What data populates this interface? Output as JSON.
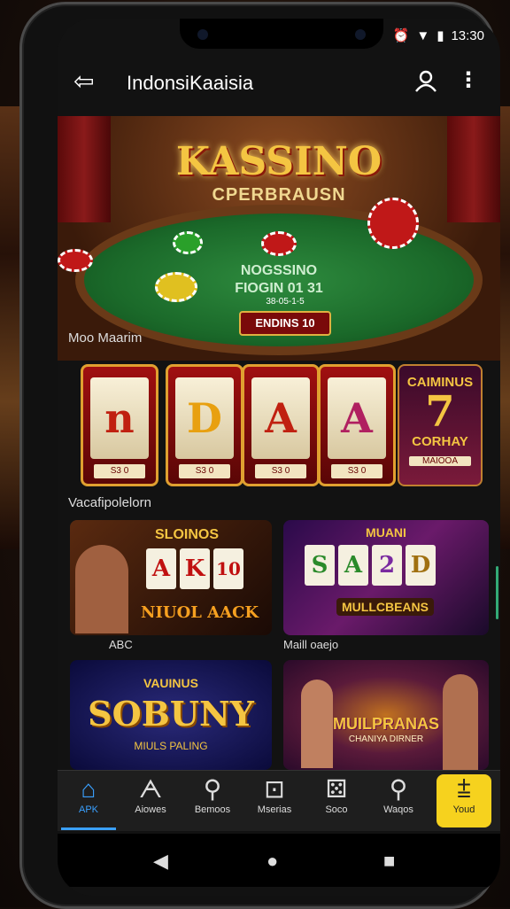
{
  "status": {
    "time": "13:30"
  },
  "appbar": {
    "title": "IndonsiKaaisia",
    "back_icon": "back-arrow-icon",
    "account_icon": "user-icon",
    "menu_icon": "more-vert-icon"
  },
  "hero": {
    "title": "KASSINO",
    "subtitle": "CPERBRAUSN",
    "table_line1": "NOGSSINO",
    "table_line2": "FIOGIN 01 31",
    "badge_top": "38-05-1-5",
    "badge": "ENDINS 10"
  },
  "sections": {
    "slots_label": "Moo Maarim",
    "featured_label": "Vacafipolelorn"
  },
  "reels": [
    {
      "symbol": "n",
      "tag": "S3 0"
    },
    {
      "symbol": "D",
      "tag": "S3 0"
    },
    {
      "symbol": "A",
      "tag": "S3 0"
    },
    {
      "symbol": "A",
      "tag": "S3 0"
    }
  ],
  "promo_tile": {
    "line1": "CAIMINUS",
    "number": "7",
    "line2": "CORHAY",
    "tag": "MAIOOA"
  },
  "cards": [
    {
      "header": "SLOINOS",
      "reels": [
        "A",
        "K",
        "10"
      ],
      "footer": "NIUOL AACK",
      "caption": "ABC"
    },
    {
      "header": "MUANI",
      "reels": [
        "S",
        "A",
        "2",
        "D"
      ],
      "footer": "MULLCBEANS",
      "caption": "Maill oaejo"
    },
    {
      "header": "VAUINUS",
      "title": "SOBUNY",
      "footer": "MIULS PALING"
    },
    {
      "header": "MUILPRANAS",
      "footer": "CHANIYA DIRNER"
    }
  ],
  "bottom_nav": [
    {
      "label": "APK",
      "icon": "home-icon",
      "active": true
    },
    {
      "label": "Aiowes",
      "icon": "chart-icon"
    },
    {
      "label": "Bemoos",
      "icon": "search-icon"
    },
    {
      "label": "Mserias",
      "icon": "gamepad-icon"
    },
    {
      "label": "Soco",
      "icon": "dice-icon"
    },
    {
      "label": "Waqos",
      "icon": "search-icon"
    },
    {
      "label": "Youd",
      "icon": "cta-icon",
      "cta": true
    }
  ],
  "colors": {
    "accent": "#3aa0ff",
    "cta": "#f6d21e",
    "gold": "#f4c542",
    "felt": "#1b6a2a"
  }
}
